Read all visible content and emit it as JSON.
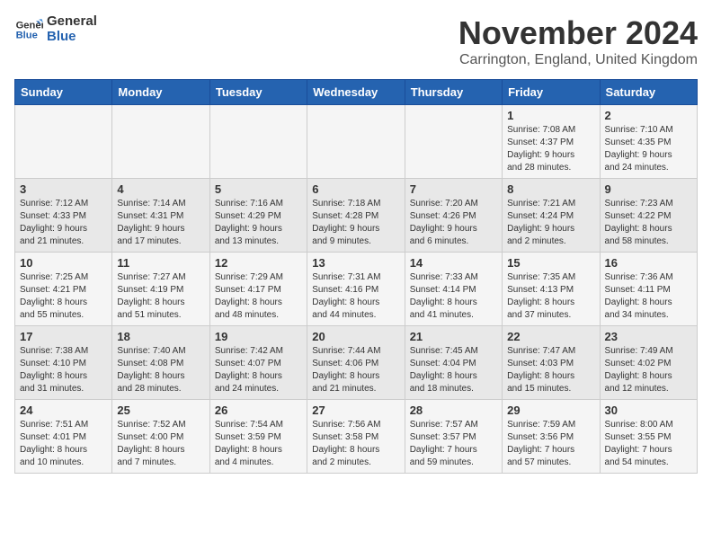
{
  "logo": {
    "line1": "General",
    "line2": "Blue"
  },
  "title": "November 2024",
  "location": "Carrington, England, United Kingdom",
  "weekdays": [
    "Sunday",
    "Monday",
    "Tuesday",
    "Wednesday",
    "Thursday",
    "Friday",
    "Saturday"
  ],
  "weeks": [
    [
      {
        "day": "",
        "info": ""
      },
      {
        "day": "",
        "info": ""
      },
      {
        "day": "",
        "info": ""
      },
      {
        "day": "",
        "info": ""
      },
      {
        "day": "",
        "info": ""
      },
      {
        "day": "1",
        "info": "Sunrise: 7:08 AM\nSunset: 4:37 PM\nDaylight: 9 hours\nand 28 minutes."
      },
      {
        "day": "2",
        "info": "Sunrise: 7:10 AM\nSunset: 4:35 PM\nDaylight: 9 hours\nand 24 minutes."
      }
    ],
    [
      {
        "day": "3",
        "info": "Sunrise: 7:12 AM\nSunset: 4:33 PM\nDaylight: 9 hours\nand 21 minutes."
      },
      {
        "day": "4",
        "info": "Sunrise: 7:14 AM\nSunset: 4:31 PM\nDaylight: 9 hours\nand 17 minutes."
      },
      {
        "day": "5",
        "info": "Sunrise: 7:16 AM\nSunset: 4:29 PM\nDaylight: 9 hours\nand 13 minutes."
      },
      {
        "day": "6",
        "info": "Sunrise: 7:18 AM\nSunset: 4:28 PM\nDaylight: 9 hours\nand 9 minutes."
      },
      {
        "day": "7",
        "info": "Sunrise: 7:20 AM\nSunset: 4:26 PM\nDaylight: 9 hours\nand 6 minutes."
      },
      {
        "day": "8",
        "info": "Sunrise: 7:21 AM\nSunset: 4:24 PM\nDaylight: 9 hours\nand 2 minutes."
      },
      {
        "day": "9",
        "info": "Sunrise: 7:23 AM\nSunset: 4:22 PM\nDaylight: 8 hours\nand 58 minutes."
      }
    ],
    [
      {
        "day": "10",
        "info": "Sunrise: 7:25 AM\nSunset: 4:21 PM\nDaylight: 8 hours\nand 55 minutes."
      },
      {
        "day": "11",
        "info": "Sunrise: 7:27 AM\nSunset: 4:19 PM\nDaylight: 8 hours\nand 51 minutes."
      },
      {
        "day": "12",
        "info": "Sunrise: 7:29 AM\nSunset: 4:17 PM\nDaylight: 8 hours\nand 48 minutes."
      },
      {
        "day": "13",
        "info": "Sunrise: 7:31 AM\nSunset: 4:16 PM\nDaylight: 8 hours\nand 44 minutes."
      },
      {
        "day": "14",
        "info": "Sunrise: 7:33 AM\nSunset: 4:14 PM\nDaylight: 8 hours\nand 41 minutes."
      },
      {
        "day": "15",
        "info": "Sunrise: 7:35 AM\nSunset: 4:13 PM\nDaylight: 8 hours\nand 37 minutes."
      },
      {
        "day": "16",
        "info": "Sunrise: 7:36 AM\nSunset: 4:11 PM\nDaylight: 8 hours\nand 34 minutes."
      }
    ],
    [
      {
        "day": "17",
        "info": "Sunrise: 7:38 AM\nSunset: 4:10 PM\nDaylight: 8 hours\nand 31 minutes."
      },
      {
        "day": "18",
        "info": "Sunrise: 7:40 AM\nSunset: 4:08 PM\nDaylight: 8 hours\nand 28 minutes."
      },
      {
        "day": "19",
        "info": "Sunrise: 7:42 AM\nSunset: 4:07 PM\nDaylight: 8 hours\nand 24 minutes."
      },
      {
        "day": "20",
        "info": "Sunrise: 7:44 AM\nSunset: 4:06 PM\nDaylight: 8 hours\nand 21 minutes."
      },
      {
        "day": "21",
        "info": "Sunrise: 7:45 AM\nSunset: 4:04 PM\nDaylight: 8 hours\nand 18 minutes."
      },
      {
        "day": "22",
        "info": "Sunrise: 7:47 AM\nSunset: 4:03 PM\nDaylight: 8 hours\nand 15 minutes."
      },
      {
        "day": "23",
        "info": "Sunrise: 7:49 AM\nSunset: 4:02 PM\nDaylight: 8 hours\nand 12 minutes."
      }
    ],
    [
      {
        "day": "24",
        "info": "Sunrise: 7:51 AM\nSunset: 4:01 PM\nDaylight: 8 hours\nand 10 minutes."
      },
      {
        "day": "25",
        "info": "Sunrise: 7:52 AM\nSunset: 4:00 PM\nDaylight: 8 hours\nand 7 minutes."
      },
      {
        "day": "26",
        "info": "Sunrise: 7:54 AM\nSunset: 3:59 PM\nDaylight: 8 hours\nand 4 minutes."
      },
      {
        "day": "27",
        "info": "Sunrise: 7:56 AM\nSunset: 3:58 PM\nDaylight: 8 hours\nand 2 minutes."
      },
      {
        "day": "28",
        "info": "Sunrise: 7:57 AM\nSunset: 3:57 PM\nDaylight: 7 hours\nand 59 minutes."
      },
      {
        "day": "29",
        "info": "Sunrise: 7:59 AM\nSunset: 3:56 PM\nDaylight: 7 hours\nand 57 minutes."
      },
      {
        "day": "30",
        "info": "Sunrise: 8:00 AM\nSunset: 3:55 PM\nDaylight: 7 hours\nand 54 minutes."
      }
    ]
  ]
}
